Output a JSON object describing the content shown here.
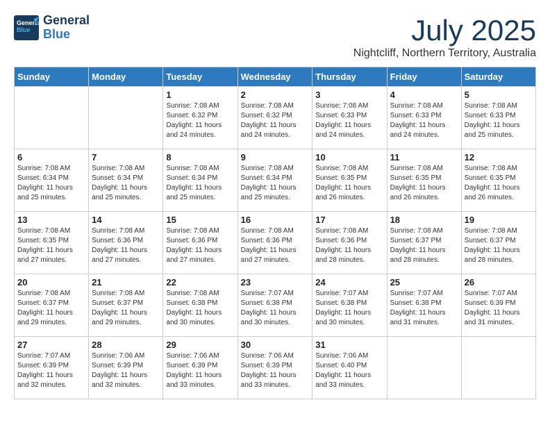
{
  "header": {
    "logo": {
      "line1": "General",
      "line2": "Blue"
    },
    "month": "July 2025",
    "location": "Nightcliff, Northern Territory, Australia"
  },
  "weekdays": [
    "Sunday",
    "Monday",
    "Tuesday",
    "Wednesday",
    "Thursday",
    "Friday",
    "Saturday"
  ],
  "weeks": [
    [
      {
        "day": null
      },
      {
        "day": null
      },
      {
        "day": "1",
        "sunrise": "Sunrise: 7:08 AM",
        "sunset": "Sunset: 6:32 PM",
        "daylight": "Daylight: 11 hours and 24 minutes."
      },
      {
        "day": "2",
        "sunrise": "Sunrise: 7:08 AM",
        "sunset": "Sunset: 6:32 PM",
        "daylight": "Daylight: 11 hours and 24 minutes."
      },
      {
        "day": "3",
        "sunrise": "Sunrise: 7:08 AM",
        "sunset": "Sunset: 6:33 PM",
        "daylight": "Daylight: 11 hours and 24 minutes."
      },
      {
        "day": "4",
        "sunrise": "Sunrise: 7:08 AM",
        "sunset": "Sunset: 6:33 PM",
        "daylight": "Daylight: 11 hours and 24 minutes."
      },
      {
        "day": "5",
        "sunrise": "Sunrise: 7:08 AM",
        "sunset": "Sunset: 6:33 PM",
        "daylight": "Daylight: 11 hours and 25 minutes."
      }
    ],
    [
      {
        "day": "6",
        "sunrise": "Sunrise: 7:08 AM",
        "sunset": "Sunset: 6:34 PM",
        "daylight": "Daylight: 11 hours and 25 minutes."
      },
      {
        "day": "7",
        "sunrise": "Sunrise: 7:08 AM",
        "sunset": "Sunset: 6:34 PM",
        "daylight": "Daylight: 11 hours and 25 minutes."
      },
      {
        "day": "8",
        "sunrise": "Sunrise: 7:08 AM",
        "sunset": "Sunset: 6:34 PM",
        "daylight": "Daylight: 11 hours and 25 minutes."
      },
      {
        "day": "9",
        "sunrise": "Sunrise: 7:08 AM",
        "sunset": "Sunset: 6:34 PM",
        "daylight": "Daylight: 11 hours and 25 minutes."
      },
      {
        "day": "10",
        "sunrise": "Sunrise: 7:08 AM",
        "sunset": "Sunset: 6:35 PM",
        "daylight": "Daylight: 11 hours and 26 minutes."
      },
      {
        "day": "11",
        "sunrise": "Sunrise: 7:08 AM",
        "sunset": "Sunset: 6:35 PM",
        "daylight": "Daylight: 11 hours and 26 minutes."
      },
      {
        "day": "12",
        "sunrise": "Sunrise: 7:08 AM",
        "sunset": "Sunset: 6:35 PM",
        "daylight": "Daylight: 11 hours and 26 minutes."
      }
    ],
    [
      {
        "day": "13",
        "sunrise": "Sunrise: 7:08 AM",
        "sunset": "Sunset: 6:35 PM",
        "daylight": "Daylight: 11 hours and 27 minutes."
      },
      {
        "day": "14",
        "sunrise": "Sunrise: 7:08 AM",
        "sunset": "Sunset: 6:36 PM",
        "daylight": "Daylight: 11 hours and 27 minutes."
      },
      {
        "day": "15",
        "sunrise": "Sunrise: 7:08 AM",
        "sunset": "Sunset: 6:36 PM",
        "daylight": "Daylight: 11 hours and 27 minutes."
      },
      {
        "day": "16",
        "sunrise": "Sunrise: 7:08 AM",
        "sunset": "Sunset: 6:36 PM",
        "daylight": "Daylight: 11 hours and 27 minutes."
      },
      {
        "day": "17",
        "sunrise": "Sunrise: 7:08 AM",
        "sunset": "Sunset: 6:36 PM",
        "daylight": "Daylight: 11 hours and 28 minutes."
      },
      {
        "day": "18",
        "sunrise": "Sunrise: 7:08 AM",
        "sunset": "Sunset: 6:37 PM",
        "daylight": "Daylight: 11 hours and 28 minutes."
      },
      {
        "day": "19",
        "sunrise": "Sunrise: 7:08 AM",
        "sunset": "Sunset: 6:37 PM",
        "daylight": "Daylight: 11 hours and 28 minutes."
      }
    ],
    [
      {
        "day": "20",
        "sunrise": "Sunrise: 7:08 AM",
        "sunset": "Sunset: 6:37 PM",
        "daylight": "Daylight: 11 hours and 29 minutes."
      },
      {
        "day": "21",
        "sunrise": "Sunrise: 7:08 AM",
        "sunset": "Sunset: 6:37 PM",
        "daylight": "Daylight: 11 hours and 29 minutes."
      },
      {
        "day": "22",
        "sunrise": "Sunrise: 7:08 AM",
        "sunset": "Sunset: 6:38 PM",
        "daylight": "Daylight: 11 hours and 30 minutes."
      },
      {
        "day": "23",
        "sunrise": "Sunrise: 7:07 AM",
        "sunset": "Sunset: 6:38 PM",
        "daylight": "Daylight: 11 hours and 30 minutes."
      },
      {
        "day": "24",
        "sunrise": "Sunrise: 7:07 AM",
        "sunset": "Sunset: 6:38 PM",
        "daylight": "Daylight: 11 hours and 30 minutes."
      },
      {
        "day": "25",
        "sunrise": "Sunrise: 7:07 AM",
        "sunset": "Sunset: 6:38 PM",
        "daylight": "Daylight: 11 hours and 31 minutes."
      },
      {
        "day": "26",
        "sunrise": "Sunrise: 7:07 AM",
        "sunset": "Sunset: 6:39 PM",
        "daylight": "Daylight: 11 hours and 31 minutes."
      }
    ],
    [
      {
        "day": "27",
        "sunrise": "Sunrise: 7:07 AM",
        "sunset": "Sunset: 6:39 PM",
        "daylight": "Daylight: 11 hours and 32 minutes."
      },
      {
        "day": "28",
        "sunrise": "Sunrise: 7:06 AM",
        "sunset": "Sunset: 6:39 PM",
        "daylight": "Daylight: 11 hours and 32 minutes."
      },
      {
        "day": "29",
        "sunrise": "Sunrise: 7:06 AM",
        "sunset": "Sunset: 6:39 PM",
        "daylight": "Daylight: 11 hours and 33 minutes."
      },
      {
        "day": "30",
        "sunrise": "Sunrise: 7:06 AM",
        "sunset": "Sunset: 6:39 PM",
        "daylight": "Daylight: 11 hours and 33 minutes."
      },
      {
        "day": "31",
        "sunrise": "Sunrise: 7:06 AM",
        "sunset": "Sunset: 6:40 PM",
        "daylight": "Daylight: 11 hours and 33 minutes."
      },
      {
        "day": null
      },
      {
        "day": null
      }
    ]
  ]
}
